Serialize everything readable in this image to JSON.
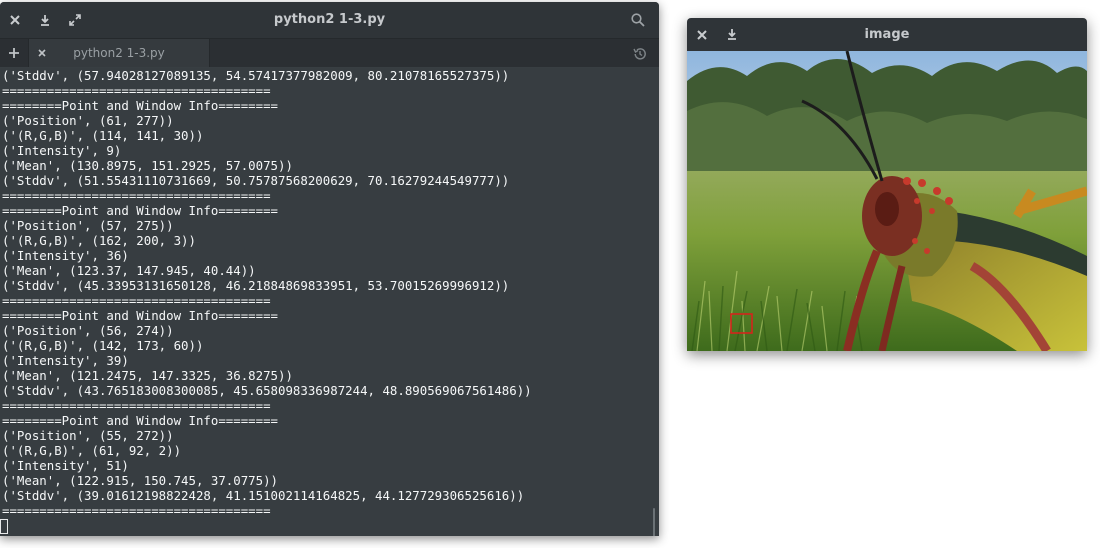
{
  "terminal": {
    "title": "python2 1-3.py",
    "tab_label": "python2 1-3.py",
    "lines": [
      "('Stddv', (57.94028127089135, 54.57417377982009, 80.21078165527375))",
      "====================================",
      "========Point and Window Info========",
      "('Position', (61, 277))",
      "('(R,G,B)', (114, 141, 30))",
      "('Intensity', 9)",
      "('Mean', (130.8975, 151.2925, 57.0075))",
      "('Stddv', (51.55431110731669, 50.75787568200629, 70.16279244549777))",
      "====================================",
      "========Point and Window Info========",
      "('Position', (57, 275))",
      "('(R,G,B)', (162, 200, 3))",
      "('Intensity', 36)",
      "('Mean', (123.37, 147.945, 40.44))",
      "('Stddv', (45.33953131650128, 46.21884869833951, 53.70015269996912))",
      "====================================",
      "========Point and Window Info========",
      "('Position', (56, 274))",
      "('(R,G,B)', (142, 173, 60))",
      "('Intensity', 39)",
      "('Mean', (121.2475, 147.3325, 36.8275))",
      "('Stddv', (43.765183008300085, 45.658098336987244, 48.890569067561486))",
      "====================================",
      "========Point and Window Info========",
      "('Position', (55, 272))",
      "('(R,G,B)', (61, 92, 2))",
      "('Intensity', 51)",
      "('Mean', (122.915, 150.745, 37.0775))",
      "('Stddv', (39.01612198822428, 41.151002114164825, 44.127729306525616))",
      "===================================="
    ]
  },
  "image_window": {
    "title": "image",
    "photo_subject": "grasshopper-on-grass",
    "selection_box_color": "#d4241c"
  },
  "colors": {
    "terminal_bg": "#373d41",
    "titlebar_bg": "#2f3438",
    "text": "#f5f7f8"
  }
}
